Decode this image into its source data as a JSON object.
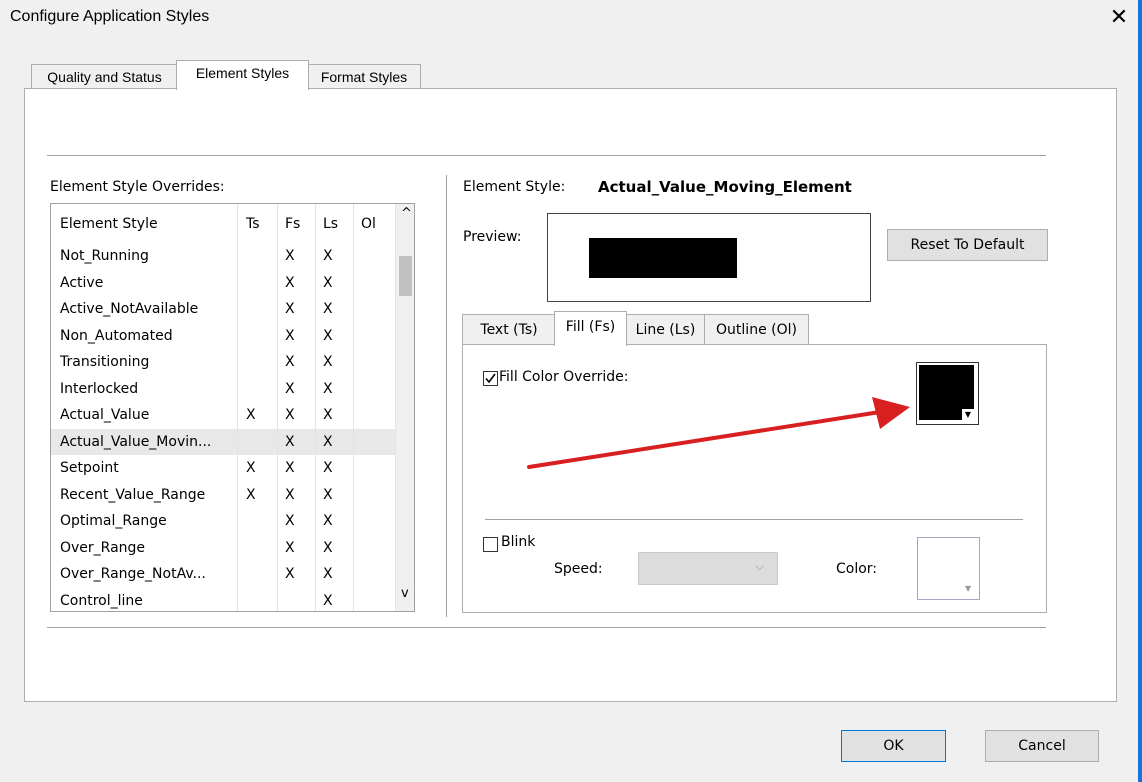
{
  "window": {
    "title": "Configure Application Styles",
    "close_glyph": "✕"
  },
  "tabs": [
    {
      "label": "Quality and Status"
    },
    {
      "label": "Element Styles"
    },
    {
      "label": "Format Styles"
    }
  ],
  "overrides": {
    "label": "Element Style Overrides:",
    "columns": [
      "Element Style",
      "Ts",
      "Fs",
      "Ls",
      "Ol"
    ],
    "rows": [
      {
        "name": "Not_Running",
        "ts": "",
        "fs": "X",
        "ls": "X",
        "ol": ""
      },
      {
        "name": "Active",
        "ts": "",
        "fs": "X",
        "ls": "X",
        "ol": ""
      },
      {
        "name": "Active_NotAvailable",
        "ts": "",
        "fs": "X",
        "ls": "X",
        "ol": ""
      },
      {
        "name": "Non_Automated",
        "ts": "",
        "fs": "X",
        "ls": "X",
        "ol": ""
      },
      {
        "name": "Transitioning",
        "ts": "",
        "fs": "X",
        "ls": "X",
        "ol": ""
      },
      {
        "name": "Interlocked",
        "ts": "",
        "fs": "X",
        "ls": "X",
        "ol": ""
      },
      {
        "name": "Actual_Value",
        "ts": "X",
        "fs": "X",
        "ls": "X",
        "ol": ""
      },
      {
        "name": "Actual_Value_Movin...",
        "ts": "",
        "fs": "X",
        "ls": "X",
        "ol": ""
      },
      {
        "name": "Setpoint",
        "ts": "X",
        "fs": "X",
        "ls": "X",
        "ol": ""
      },
      {
        "name": "Recent_Value_Range",
        "ts": "X",
        "fs": "X",
        "ls": "X",
        "ol": ""
      },
      {
        "name": "Optimal_Range",
        "ts": "",
        "fs": "X",
        "ls": "X",
        "ol": ""
      },
      {
        "name": "Over_Range",
        "ts": "",
        "fs": "X",
        "ls": "X",
        "ol": ""
      },
      {
        "name": "Over_Range_NotAv...",
        "ts": "",
        "fs": "X",
        "ls": "X",
        "ol": ""
      },
      {
        "name": "Control_line",
        "ts": "",
        "fs": "",
        "ls": "X",
        "ol": ""
      }
    ],
    "selected_index": 7,
    "scroll_up_glyph": "^",
    "scroll_down_glyph": "v"
  },
  "detail": {
    "element_style_label": "Element Style:",
    "element_style_value": "Actual_Value_Moving_Element",
    "preview_label": "Preview:",
    "preview_color": "#000000",
    "reset_button": "Reset To Default",
    "subtabs": [
      {
        "label": "Text (Ts)"
      },
      {
        "label": "Fill (Fs)"
      },
      {
        "label": "Line (Ls)"
      },
      {
        "label": "Outline (Ol)"
      }
    ],
    "fill_override_label": "Fill Color Override:",
    "fill_override_checked": true,
    "fill_color": "#000000",
    "blink_label": "Blink",
    "blink_checked": false,
    "speed_label": "Speed:",
    "speed_value": "",
    "color_label": "Color:",
    "arrow_color": "#d92020"
  },
  "footer": {
    "ok": "OK",
    "cancel": "Cancel"
  }
}
